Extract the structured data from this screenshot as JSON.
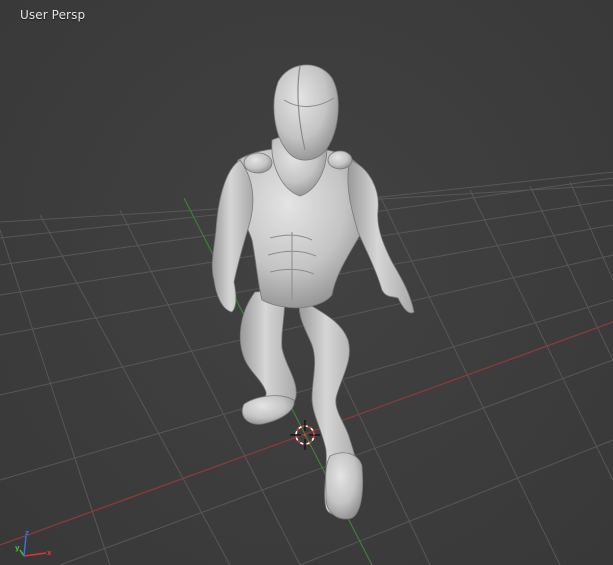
{
  "viewport": {
    "view_label": "User Persp",
    "colors": {
      "background": "#3d3d3d",
      "grid": "#5a5a5a",
      "x_axis": "#8f3a3a",
      "y_axis": "#3f7f3a",
      "model": "#c8c8c8",
      "cursor_red": "#e23c3c"
    }
  },
  "gizmo": {
    "x_label": "x",
    "y_label": "y",
    "z_label": "z",
    "x_color": "#e63232",
    "y_color": "#3cbe3c",
    "z_color": "#3c6ee6"
  },
  "icons": {
    "cursor": "3d-cursor-icon",
    "gizmo": "axis-gizmo-icon"
  }
}
